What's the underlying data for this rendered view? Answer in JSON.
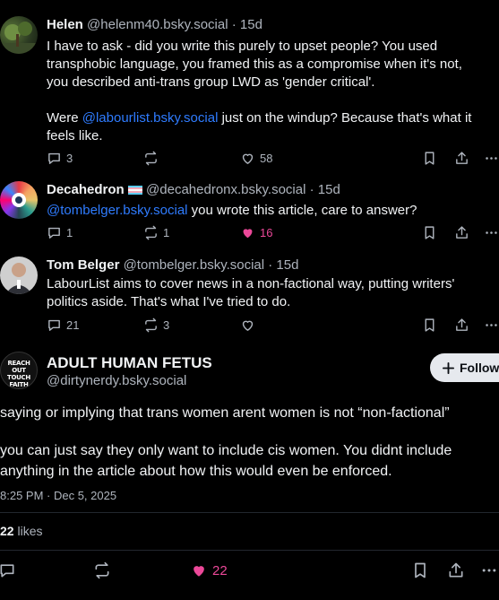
{
  "replies": [
    {
      "name": "Helen",
      "handle": "@helenm40.bsky.social",
      "time": "· 15d",
      "text1": "I have to ask - did you write this purely to upset people? You used\ntransphobic language, you framed this as a compromise when it's not,\nyou described anti-trans group LWD as 'gender critical'.",
      "text2_prefix": "Were ",
      "text2_link": "@labourlist.bsky.social",
      "text2_suffix": " just on the windup? Because that's what it\nfeels like.",
      "reply_count": "3",
      "repost_count": "",
      "like_count": "58"
    },
    {
      "name": "Decahedron",
      "flag": "🏳️‍⚧️",
      "handle": "@decahedronx.bsky.social",
      "time": "· 15d",
      "text_link": "@tombelger.bsky.social",
      "text_suffix": " you wrote this article, care to answer?",
      "reply_count": "1",
      "repost_count": "1",
      "like_count": "16"
    },
    {
      "name": "Tom Belger",
      "handle": "@tombelger.bsky.social",
      "time": "· 15d",
      "text": "LabourList aims to cover news in a non-factional way, putting writers'\npolitics aside. That's what I've tried to do.",
      "reply_count": "21",
      "repost_count": "3",
      "like_count": ""
    }
  ],
  "main_post": {
    "name": "ADULT HUMAN FETUS",
    "handle": "@dirtynerdy.bsky.social",
    "avatar_text": "REACH OUT TOUCH FAITH",
    "follow_label": "Follow",
    "text1": "saying or implying that trans women arent women is not “non-factional”",
    "text2": "you can just say they only want to include cis women. You didnt include\nanything in the article about how this would even be enforced.",
    "timestamp": "8:25 PM · Dec 5, 2025",
    "likes_count": "22",
    "likes_label": "likes",
    "like_count": "22"
  },
  "colors": {
    "background": "#000000",
    "link": "#2f7cff",
    "liked": "#ec4899",
    "muted": "#aeb4bd"
  }
}
